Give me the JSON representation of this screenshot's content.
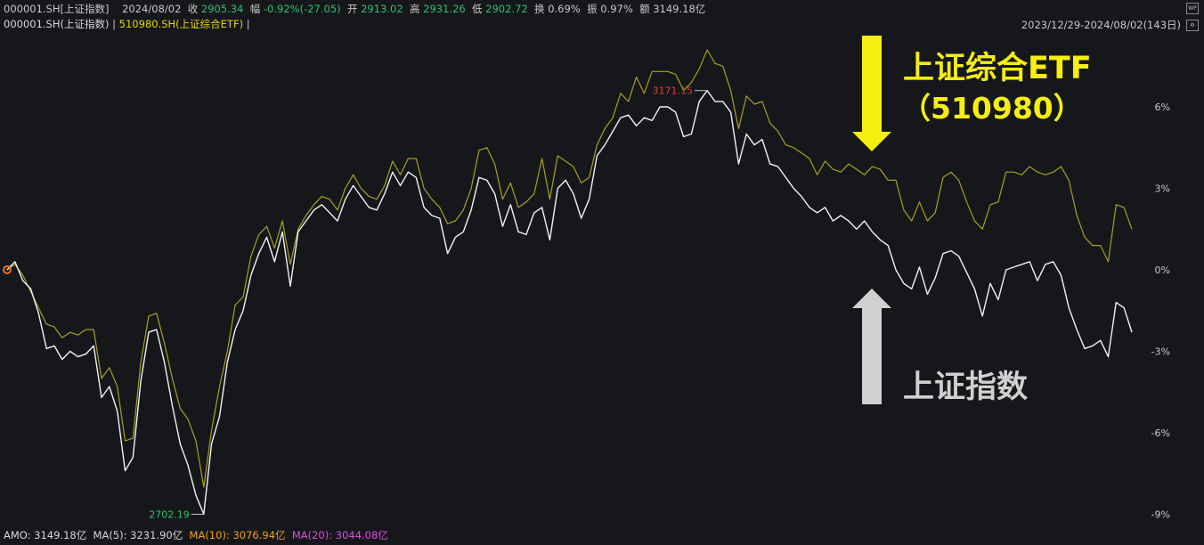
{
  "header": {
    "symbol": "000001.SH[上证指数]",
    "date": "2024/08/02",
    "close_label": "收",
    "close_value": "2905.34",
    "change_label": "幅",
    "change_value": "-0.92%(-27.05)",
    "open_label": "开",
    "open_value": "2913.02",
    "high_label": "高",
    "high_value": "2931.26",
    "low_label": "低",
    "low_value": "2902.72",
    "turnover_label": "换",
    "turnover_value": "0.69%",
    "amplitude_label": "振",
    "amplitude_value": "0.97%",
    "amount_label": "额",
    "amount_value": "3149.18亿"
  },
  "legend": {
    "series1": "000001.SH(上证指数)",
    "separator": " | ",
    "series2": "510980.SH(上证综合ETF)",
    "trail": " |"
  },
  "range_label": "2023/12/29-2024/08/02(143日)",
  "footer": {
    "amo": "AMO: 3149.18亿",
    "ma5": "MA(5): 3231.90亿",
    "ma10": "MA(10): 3076.94亿",
    "ma20": "MA(20): 3044.08亿"
  },
  "annotations": {
    "etf_line1": "上证综合ETF",
    "etf_line2": "（510980）",
    "index": "上证指数",
    "max_label": "3171.15",
    "min_label": "2702.19"
  },
  "colors": {
    "background": "#16171b",
    "index_line": "#f2f2f2",
    "etf_line": "#a8a020",
    "annotation_yellow": "#f5ee10",
    "annotation_grey": "#d0d0d0",
    "axis_text": "#c8c8c8",
    "max_label": "#e03a3a",
    "min_label": "#2fc26e"
  },
  "chart_data": {
    "type": "line",
    "ylim": [
      -9,
      8.5
    ],
    "yticks": [
      6,
      3,
      0,
      -3,
      -6,
      -9
    ],
    "ytick_labels": [
      "6%",
      "3%",
      "0%",
      "-3%",
      "-6%",
      "-9%"
    ],
    "series": [
      {
        "name": "000001.SH(上证指数)",
        "values": [
          0,
          0.3,
          -0.4,
          -0.7,
          -1.6,
          -2.9,
          -2.8,
          -3.3,
          -3.0,
          -3.2,
          -3.1,
          -2.8,
          -4.7,
          -4.3,
          -5.2,
          -7.4,
          -6.9,
          -4.1,
          -2.3,
          -2.2,
          -3.4,
          -5.0,
          -6.4,
          -7.2,
          -8.3,
          -9.0,
          -6.4,
          -5.4,
          -3.4,
          -2.2,
          -1.5,
          -0.2,
          0.6,
          1.2,
          0.3,
          1.4,
          -0.6,
          1.4,
          1.8,
          2.2,
          2.4,
          2.1,
          1.8,
          2.6,
          3.1,
          2.7,
          2.3,
          2.2,
          2.8,
          3.6,
          3.1,
          3.6,
          3.4,
          2.3,
          2.0,
          1.9,
          0.6,
          1.2,
          1.4,
          2.2,
          3.4,
          3.3,
          2.8,
          1.6,
          2.4,
          1.4,
          1.3,
          2.1,
          2.3,
          1.1,
          3.0,
          3.3,
          2.8,
          1.9,
          2.6,
          4.2,
          4.6,
          5.1,
          5.6,
          5.7,
          5.3,
          5.6,
          5.5,
          6.0,
          6.0,
          5.8,
          4.9,
          5.0,
          6.2,
          6.6,
          6.2,
          6.2,
          5.8,
          3.9,
          5.0,
          4.6,
          4.8,
          3.9,
          3.8,
          3.4,
          3.0,
          2.7,
          2.3,
          2.1,
          2.3,
          1.8,
          2.0,
          1.8,
          1.5,
          1.8,
          1.4,
          1.1,
          0.9,
          0.0,
          -0.5,
          -0.7,
          0.1,
          -0.9,
          -0.3,
          0.6,
          0.7,
          0.5,
          -0.1,
          -0.7,
          -1.7,
          -0.5,
          -1.1,
          0.0,
          0.1,
          0.2,
          0.3,
          -0.4,
          0.2,
          0.3,
          -0.2,
          -1.4,
          -2.2,
          -2.9,
          -2.8,
          -2.6,
          -3.2,
          -1.2,
          -1.4,
          -2.3
        ]
      },
      {
        "name": "510980.SH(上证综合ETF)",
        "values": [
          0,
          0.2,
          -0.2,
          -0.8,
          -1.4,
          -2.0,
          -2.1,
          -2.5,
          -2.3,
          -2.4,
          -2.2,
          -2.2,
          -4.0,
          -3.6,
          -4.3,
          -6.3,
          -6.2,
          -3.4,
          -1.7,
          -1.6,
          -2.7,
          -4.0,
          -5.1,
          -5.5,
          -6.3,
          -8.0,
          -5.9,
          -4.3,
          -3.0,
          -1.3,
          -1.0,
          0.5,
          1.3,
          1.6,
          0.8,
          1.8,
          0.2,
          1.5,
          2.0,
          2.4,
          2.7,
          2.6,
          2.2,
          3.0,
          3.5,
          3.0,
          2.7,
          2.6,
          3.1,
          4.0,
          3.5,
          4.1,
          4.1,
          3.0,
          2.6,
          2.3,
          1.7,
          1.8,
          2.2,
          3.0,
          4.4,
          4.5,
          3.9,
          2.6,
          3.2,
          2.3,
          2.5,
          2.8,
          4.1,
          2.6,
          4.2,
          4.0,
          3.8,
          3.2,
          3.4,
          4.6,
          5.2,
          5.6,
          6.5,
          6.2,
          7.1,
          6.5,
          7.3,
          7.3,
          7.3,
          7.2,
          6.6,
          6.9,
          7.4,
          8.1,
          7.6,
          7.5,
          6.6,
          5.2,
          6.4,
          6.1,
          6.2,
          5.4,
          5.1,
          4.6,
          4.5,
          4.3,
          4.1,
          3.5,
          4.0,
          3.7,
          3.6,
          3.9,
          3.7,
          3.5,
          3.8,
          3.7,
          3.3,
          3.3,
          2.2,
          1.8,
          2.5,
          1.8,
          2.1,
          3.4,
          3.6,
          3.3,
          2.5,
          1.8,
          1.5,
          2.4,
          2.5,
          3.6,
          3.6,
          3.5,
          3.8,
          3.6,
          3.5,
          3.6,
          3.8,
          3.3,
          2.0,
          1.2,
          0.9,
          0.9,
          0.3,
          2.4,
          2.3,
          1.5
        ]
      }
    ]
  }
}
